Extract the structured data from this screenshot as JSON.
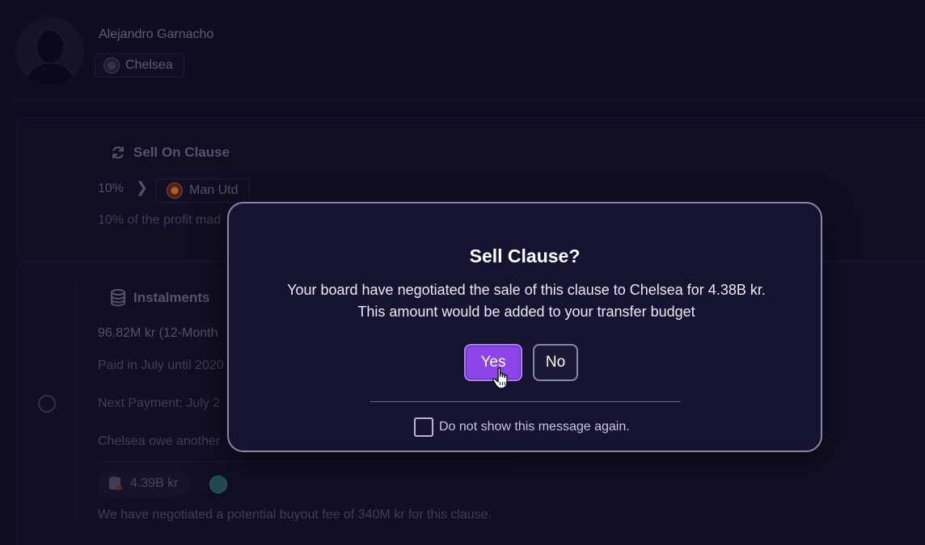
{
  "player": {
    "name": "Alejandro Garnacho",
    "club": "Chelsea"
  },
  "sell_on_clause": {
    "title": "Sell On Clause",
    "percent": "10%",
    "club": "Man Utd",
    "description_partial": "10% of the profit mad"
  },
  "instalments": {
    "title": "Instalments",
    "amount_partial": "96.82M kr (12-Month",
    "paid_partial": "Paid in July until 2020",
    "next_payment_partial": "Next Payment: July 2",
    "owe_partial": "Chelsea owe another",
    "budget_value": "4.39B kr",
    "buyout_note": "We have negotiated a potential buyout fee of 340M kr for this clause."
  },
  "dialog": {
    "title": "Sell Clause?",
    "body": "Your board have negotiated the sale of this clause to Chelsea for 4.38B kr. This amount would be added to your transfer budget",
    "yes_label": "Yes",
    "no_label": "No",
    "dont_show_label": "Do not show this message again."
  },
  "colors": {
    "accent": "#8c45e6",
    "accent_border": "#b47cff",
    "background": "#12112a",
    "dialog_bg": "#141330"
  },
  "icons": {
    "sell_on_clause": "refresh-icon",
    "instalments": "coins-stack-icon",
    "cursor": "hand-pointer-icon"
  }
}
